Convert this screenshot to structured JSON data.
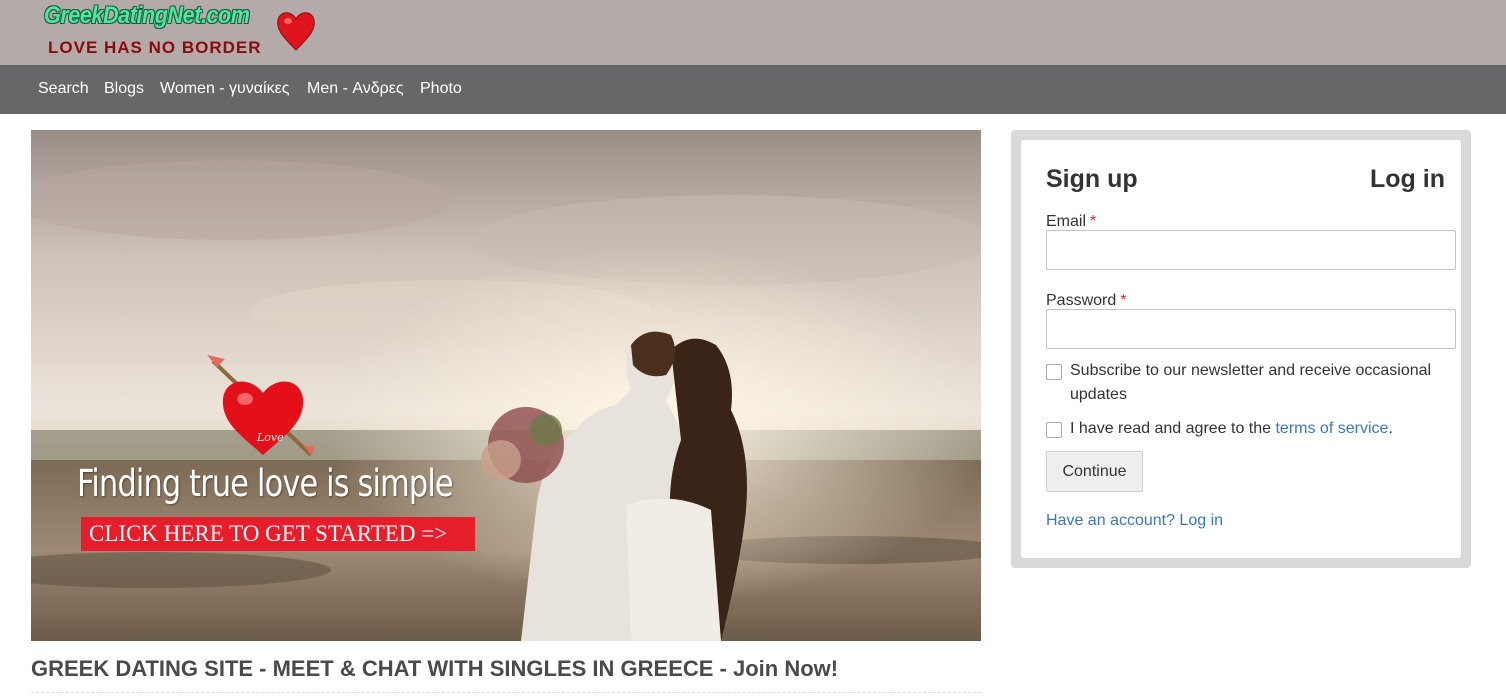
{
  "header": {
    "logo_top": "GreekDatingNet.com",
    "logo_bottom": "LOVE HAS NO BORDER"
  },
  "nav": {
    "items": [
      {
        "label": "Search"
      },
      {
        "label": "Blogs"
      },
      {
        "label": "Women - γυναίκες"
      },
      {
        "label": "Men - Ανδρες"
      },
      {
        "label": "Photo"
      }
    ]
  },
  "hero": {
    "heading": "Finding true love is simple",
    "cta": "CLICK HERE TO GET STARTED =>",
    "heart_text": "Love"
  },
  "main": {
    "title": "GREEK DATING SITE - MEET & CHAT WITH SINGLES IN GREECE - Join Now!"
  },
  "form": {
    "tab_signup": "Sign up",
    "tab_login": "Log in",
    "email_label": "Email",
    "password_label": "Password",
    "required_mark": "*",
    "email_value": "",
    "password_value": "",
    "newsletter_label": "Subscribe to our newsletter and receive occasional updates",
    "newsletter_checked": false,
    "terms_prefix": "I have read and agree to the ",
    "terms_link": "terms of service",
    "terms_suffix": ".",
    "terms_checked": false,
    "continue_label": "Continue",
    "have_account": "Have an account? Log in"
  },
  "colors": {
    "header_bg": "#b4aaa9",
    "nav_bg": "#666769",
    "cta_red": "#e61e2c",
    "link_blue": "#3b76b8",
    "required_red": "#c0322e"
  }
}
